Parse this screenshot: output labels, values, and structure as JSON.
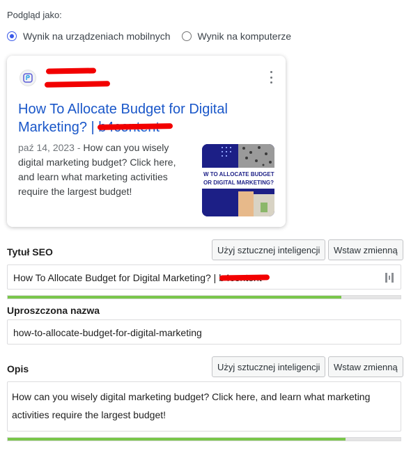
{
  "preview": {
    "label": "Podgląd jako:",
    "options": [
      {
        "label": "Wynik na urządzeniach mobilnych",
        "selected": true
      },
      {
        "label": "Wynik na komputerze",
        "selected": false
      }
    ]
  },
  "serp": {
    "title": "How To Allocate Budget for Digital Marketing? | b4content",
    "date": "paź 14, 2023",
    "separator": "-",
    "description": "How can you wisely digital marketing budget? Click here, and learn what marketing activities require the largest budget!",
    "thumbnail_text": "W TO ALLOCATE BUDGET\nOR DIGITAL MARKETING?"
  },
  "seo_title": {
    "label": "Tytuł SEO",
    "ai_button": "Użyj sztucznej inteligencji",
    "variable_button": "Wstaw zmienną",
    "value": "How To Allocate Budget for Digital Marketing? | b4content",
    "progress": 0.85
  },
  "slug": {
    "label": "Uproszczona nazwa",
    "value": "how-to-allocate-budget-for-digital-marketing"
  },
  "description": {
    "label": "Opis",
    "ai_button": "Użyj sztucznej inteligencji",
    "variable_button": "Wstaw zmienną",
    "value": "How can you wisely digital marketing budget? Click here, and learn what marketing activities require the largest budget!",
    "progress": 0.86
  },
  "colors": {
    "link_blue": "#1a57c9",
    "radio_accent": "#3858e9",
    "progress_green": "#7ac64b",
    "redaction_red": "#f20000"
  }
}
